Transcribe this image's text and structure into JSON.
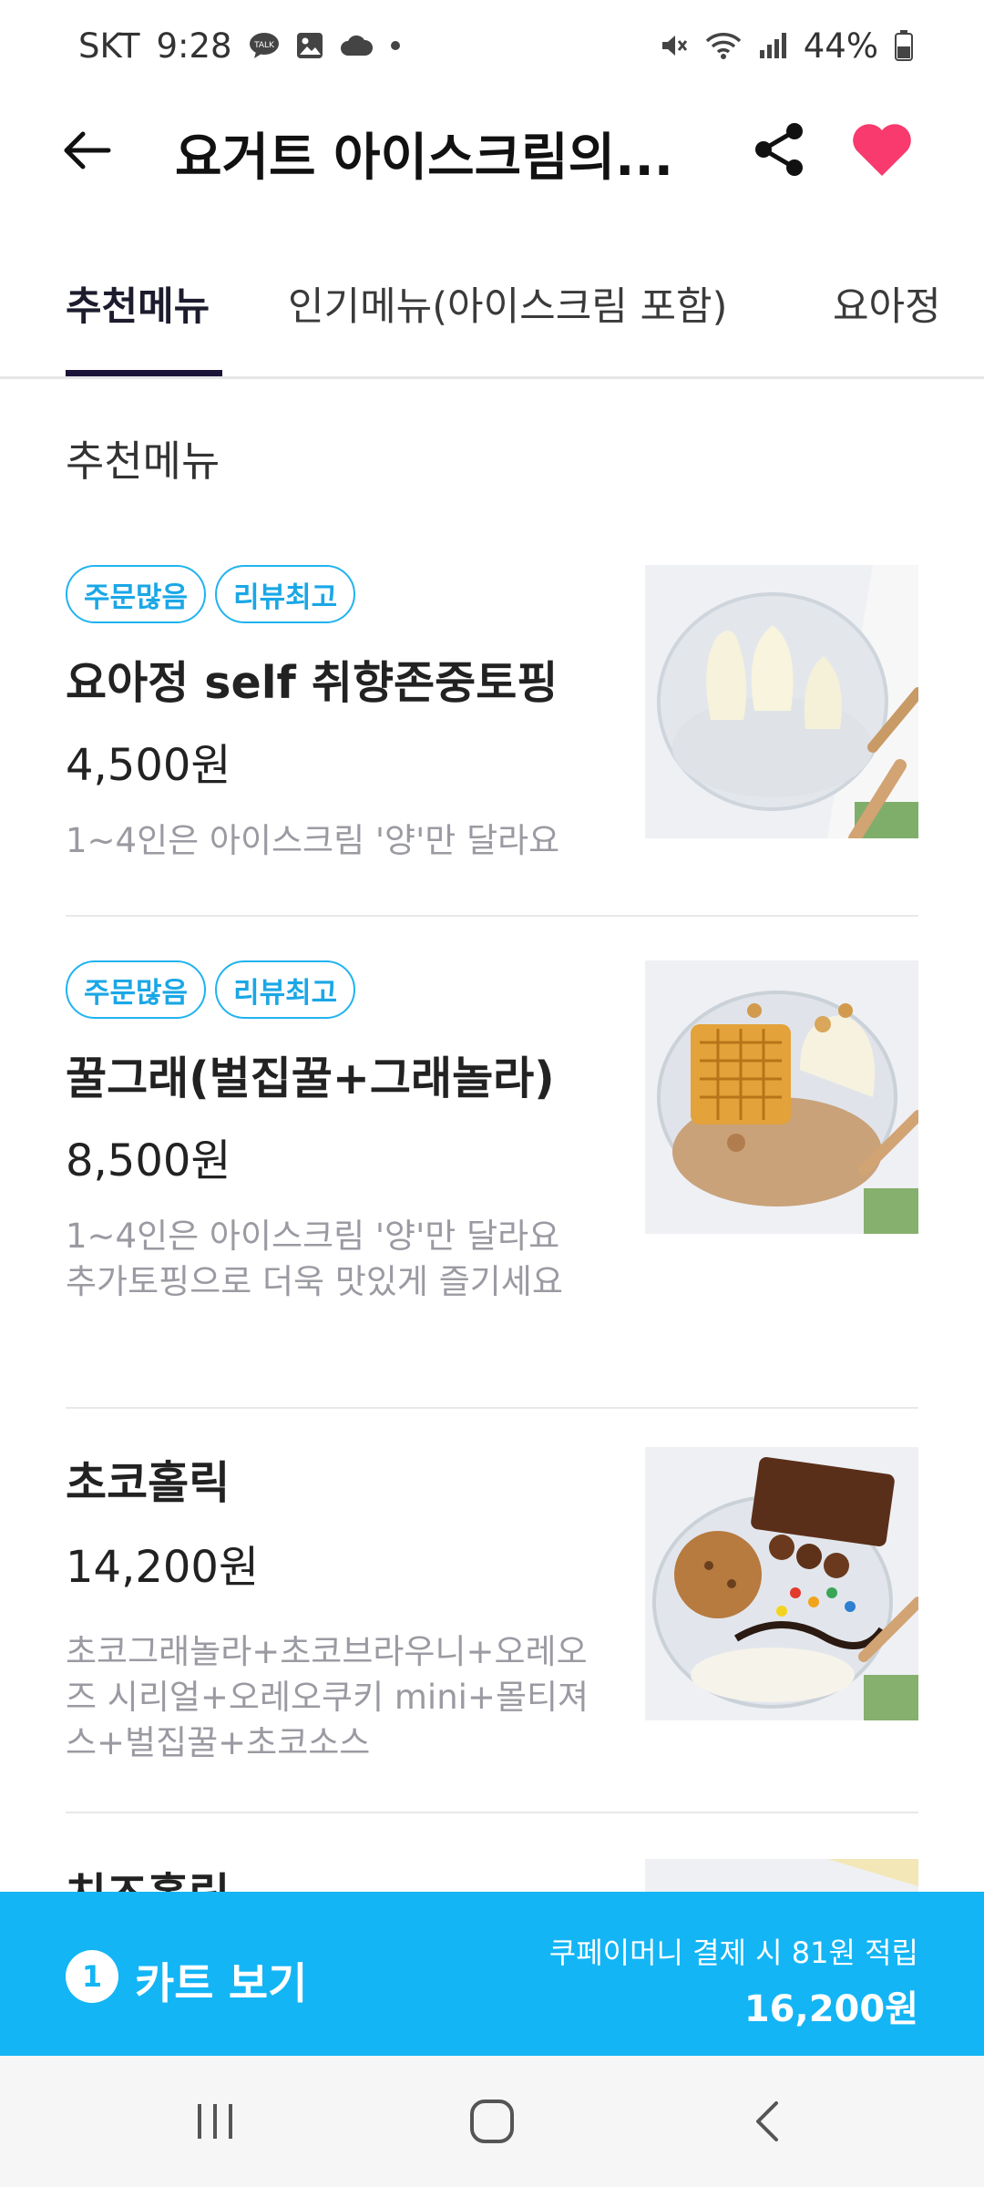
{
  "status_bar": {
    "carrier": "SKT",
    "time": "9:28",
    "battery": "44%",
    "icons": [
      "talk-icon",
      "gallery-icon",
      "cloud-icon",
      "dot-icon",
      "mute-icon",
      "wifi-icon",
      "signal-icon",
      "battery-icon"
    ]
  },
  "header": {
    "title": "요거트 아이스크림의...",
    "heart_color": "#f83a6e"
  },
  "tabs": [
    {
      "label": "추천메뉴",
      "active": true
    },
    {
      "label": "인기메뉴(아이스크림 포함)",
      "active": false
    },
    {
      "label": "요아정",
      "active": false
    }
  ],
  "section": {
    "title": "추천메뉴"
  },
  "menu_items": [
    {
      "badges": [
        "주문많음",
        "리뷰최고"
      ],
      "name": "요아정 self 취향존중토핑",
      "price": "4,500원",
      "description": "1~4인은 아이스크림 '양'만 달라요"
    },
    {
      "badges": [
        "주문많음",
        "리뷰최고"
      ],
      "name": "꿀그래(벌집꿀+그래놀라)",
      "price": "8,500원",
      "description": "1~4인은 아이스크림 '양'만 달라요 추가토핑으로 더욱 맛있게 즐기세요"
    },
    {
      "badges": [],
      "name": "초코홀릭",
      "price": "14,200원",
      "description": "초코그래놀라+초코브라우니+오레오즈 시리얼+오레오쿠키 mini+몰티져스+벌집꿀+초코소스"
    },
    {
      "badges": [],
      "name": "치즈홀릭",
      "price": "",
      "description": ""
    }
  ],
  "cart": {
    "count": "1",
    "label": "카트 보기",
    "points_text": "쿠페이머니 결제 시 81원 적립",
    "total": "16,200원",
    "color": "#13b5f5"
  },
  "nav": {
    "icons": [
      "recent-apps-icon",
      "home-icon",
      "back-nav-icon"
    ]
  }
}
